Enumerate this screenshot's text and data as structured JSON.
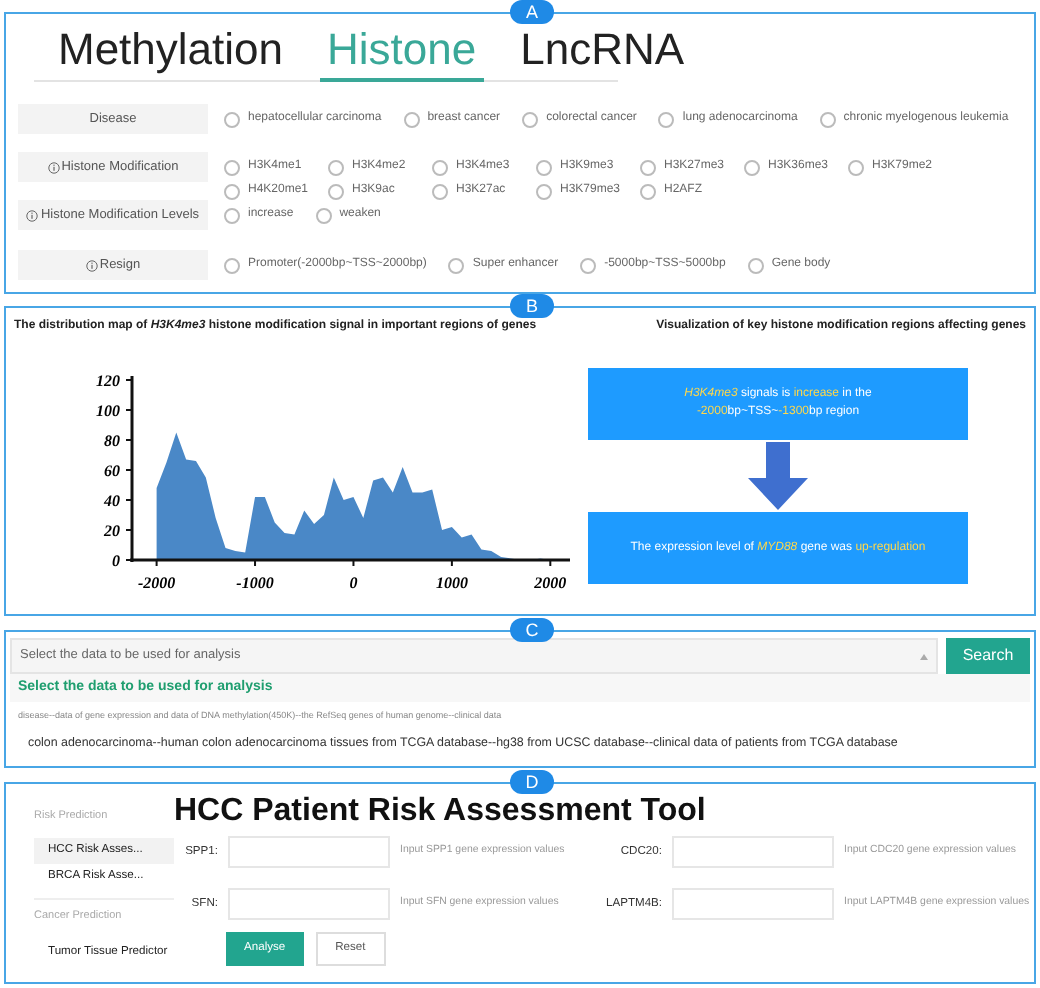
{
  "panels": {
    "a": {
      "badge": "A",
      "tabs": [
        {
          "label": "Methylation",
          "selected": false
        },
        {
          "label": "Histone",
          "selected": true
        },
        {
          "label": "LncRNA",
          "selected": false
        }
      ],
      "filters": [
        {
          "label": "Disease",
          "info": false,
          "options": [
            {
              "label": "hepatocellular carcinoma",
              "selected": false
            },
            {
              "label": "breast cancer",
              "selected": false
            },
            {
              "label": "colorectal cancer",
              "selected": false
            },
            {
              "label": "lung adenocarcinoma",
              "selected": false
            },
            {
              "label": "chronic myelogenous leukemia",
              "selected": false
            }
          ]
        },
        {
          "label": "Histone Modification",
          "info": true,
          "options": [
            {
              "label": "H3K4me1",
              "selected": false
            },
            {
              "label": "H3K4me2",
              "selected": false
            },
            {
              "label": "H3K4me3",
              "selected": false
            },
            {
              "label": "H3K9me3",
              "selected": false
            },
            {
              "label": "H3K27me3",
              "selected": false
            },
            {
              "label": "H3K36me3",
              "selected": false
            },
            {
              "label": "H3K79me2",
              "selected": false
            },
            {
              "label": "H4K20me1",
              "selected": false
            },
            {
              "label": "H3K9ac",
              "selected": false
            },
            {
              "label": "H3K27ac",
              "selected": false
            },
            {
              "label": "H3K79me3",
              "selected": false
            },
            {
              "label": "H2AFZ",
              "selected": false
            }
          ]
        },
        {
          "label": "Histone Modification Levels",
          "info": true,
          "options": [
            {
              "label": "increase",
              "selected": false
            },
            {
              "label": "weaken",
              "selected": false
            }
          ]
        },
        {
          "label": "Resign",
          "info": true,
          "options": [
            {
              "label": "Promoter(-2000bp~TSS~2000bp)",
              "selected": false
            },
            {
              "label": "Super enhancer",
              "selected": false
            },
            {
              "label": "-5000bp~TSS~5000bp",
              "selected": false
            },
            {
              "label": "Gene body",
              "selected": false
            }
          ]
        }
      ]
    },
    "b": {
      "badge": "B",
      "title_left": "The distribution map of *H3K4me3* histone modification signal in important regions of genes",
      "title_right": "Visualization of key histone modification regions affecting genes",
      "chart_data": {
        "type": "area",
        "x": [
          -2000,
          -1900,
          -1800,
          -1700,
          -1600,
          -1500,
          -1400,
          -1300,
          -1200,
          -1100,
          -1000,
          -900,
          -800,
          -700,
          -600,
          -500,
          -400,
          -300,
          -200,
          -100,
          0,
          100,
          200,
          300,
          400,
          500,
          600,
          700,
          800,
          900,
          1000,
          1100,
          1200,
          1300,
          1400,
          1500,
          1600,
          1700,
          1800,
          1900,
          2000
        ],
        "series": [
          {
            "color": "#4a88c7",
            "values": [
              48,
              65,
              85,
              67,
              66,
              55,
              28,
              8,
              6,
              5,
              42,
              42,
              25,
              18,
              17,
              33,
              24,
              30,
              55,
              40,
              42,
              28,
              53,
              55,
              45,
              62,
              45,
              45,
              47,
              20,
              22,
              15,
              17,
              7,
              6,
              2,
              1,
              0,
              0,
              1,
              0
            ]
          }
        ],
        "xticks": [
          -2000,
          -1000,
          0,
          1000,
          2000
        ],
        "yticks": [
          0,
          20,
          40,
          60,
          80,
          100,
          120
        ],
        "xlim": [
          -2250,
          2200
        ],
        "ylim": [
          0,
          120
        ]
      },
      "flow": [
        [
          {
            "text": "H3K4me3",
            "highlight": true,
            "italic": true
          },
          {
            "text": " signals is "
          },
          {
            "text": "increase",
            "highlight": true
          },
          {
            "text": " in the "
          },
          {
            "text": "-2000",
            "highlight": true
          },
          {
            "text": "bp~TSS~"
          },
          {
            "text": "-1300",
            "highlight": true
          },
          {
            "text": "bp region"
          }
        ],
        [
          {
            "text": "The expression level of "
          },
          {
            "text": "MYD88",
            "highlight": true,
            "italic": true
          },
          {
            "text": " gene was "
          },
          {
            "text": "up-regulation",
            "highlight": true
          }
        ]
      ]
    },
    "c": {
      "badge": "C",
      "select": {
        "placeholder": "Select the data to be used for analysis"
      },
      "search_button": "Search",
      "dropdown_heading": "Select the data to be used for analysis",
      "dropdown_hint": "disease--data of gene expression and data of DNA methylation(450K)--the RefSeq genes of human genome--clinical data",
      "dropdown_option": "colon adenocarcinoma--human colon adenocarcinoma tissues from TCGA database--hg38 from UCSC database--clinical data of patients from TCGA database"
    },
    "d": {
      "badge": "D",
      "sidebar": [
        {
          "title": "Risk Prediction",
          "items": [
            {
              "label": "HCC Risk Asses...",
              "selected": true
            },
            {
              "label": "BRCA Risk Asse...",
              "selected": false
            }
          ]
        },
        {
          "title": "Cancer Prediction",
          "items": [
            {
              "label": "Tumor Tissue Predictor",
              "selected": false
            }
          ]
        }
      ],
      "title": "HCC Patient Risk Assessment Tool",
      "fields": [
        {
          "label": "SPP1:",
          "hint": "Input SPP1 gene expression values"
        },
        {
          "label": "CDC20:",
          "hint": "Input CDC20 gene expression values"
        },
        {
          "label": "SFN:",
          "hint": "Input SFN gene expression values"
        },
        {
          "label": "LAPTM4B:",
          "hint": "Input LAPTM4B gene expression values"
        }
      ],
      "buttons": [
        "Analyse",
        "Reset"
      ]
    }
  }
}
